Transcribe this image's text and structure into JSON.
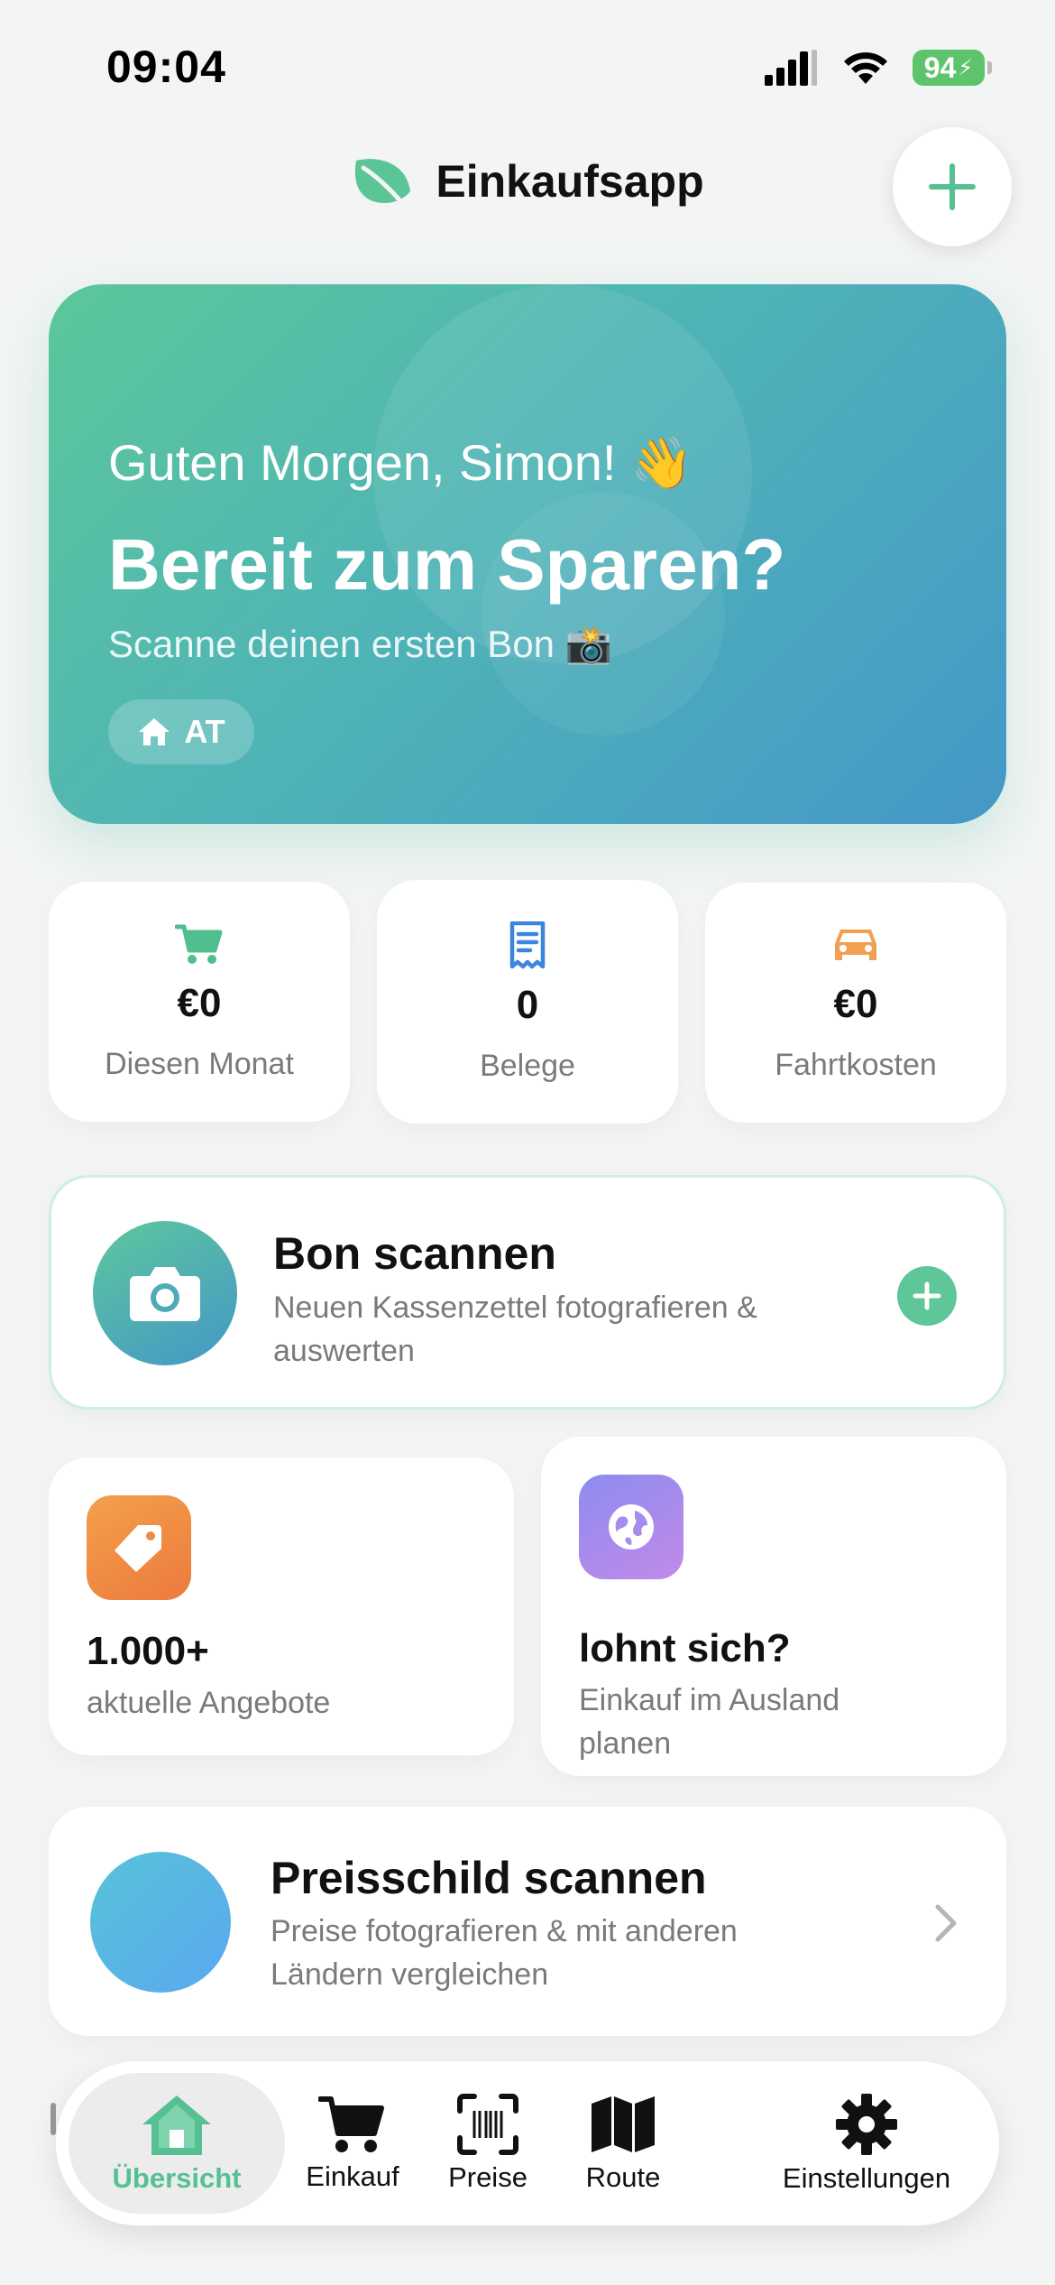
{
  "status_bar": {
    "time": "09:04",
    "battery": "94"
  },
  "header": {
    "app_title": "Einkaufsapp"
  },
  "hero": {
    "greeting": "Guten Morgen, Simon! 👋",
    "title": "Bereit zum Sparen?",
    "subtitle": "Scanne deinen ersten Bon 📸",
    "country_chip": "AT"
  },
  "stats": [
    {
      "value": "€0",
      "label": "Diesen Monat",
      "icon": "cart-icon",
      "color": "#4fc08d"
    },
    {
      "value": "0",
      "label": "Belege",
      "icon": "receipt-icon",
      "color": "#3d86e0"
    },
    {
      "value": "€0",
      "label": "Fahrtkosten",
      "icon": "car-icon",
      "color": "#f0a050"
    }
  ],
  "scan_receipt": {
    "title": "Bon scannen",
    "subtitle": "Neuen Kassenzettel fotografieren & auswerten"
  },
  "offers": {
    "value": "1.000+",
    "label": "aktuelle Angebote"
  },
  "abroad": {
    "title": "lohnt sich?",
    "subtitle": "Einkauf im Ausland planen"
  },
  "price_tag": {
    "title": "Preisschild scannen",
    "subtitle": "Preise fotografieren & mit anderen Ländern vergleichen"
  },
  "nav": {
    "items": [
      {
        "label": "Übersicht",
        "icon": "home-icon",
        "active": true
      },
      {
        "label": "Einkauf",
        "icon": "cart-icon"
      },
      {
        "label": "Preise",
        "icon": "barcode-scan-icon"
      },
      {
        "label": "Route",
        "icon": "map-icon"
      },
      {
        "label": "Einstellungen",
        "icon": "gear-icon"
      }
    ]
  },
  "colors": {
    "accent": "#56c093",
    "hero_start": "#5cc79a",
    "hero_end": "#4597c8"
  }
}
